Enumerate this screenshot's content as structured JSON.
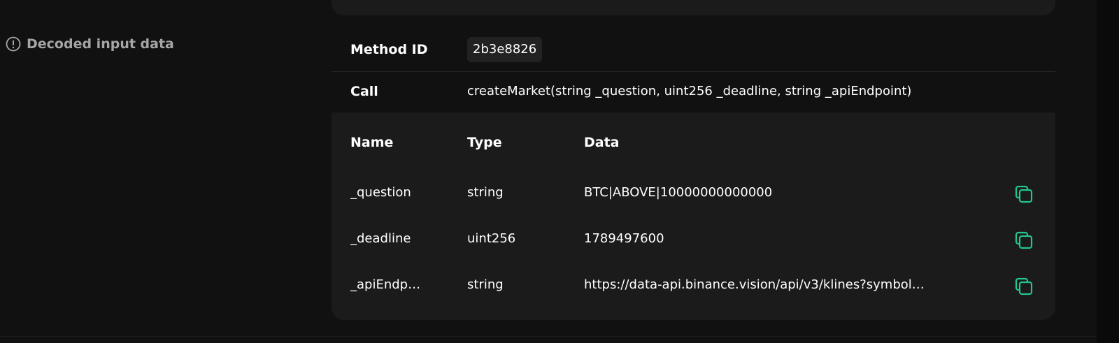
{
  "section": {
    "label": "Decoded input data",
    "icon": "info-circle-icon"
  },
  "method": {
    "label": "Method ID",
    "value": "2b3e8826"
  },
  "call": {
    "label": "Call",
    "value": "createMarket(string _question, uint256 _deadline, string _apiEndpoint)"
  },
  "params": {
    "headers": {
      "name": "Name",
      "type": "Type",
      "data": "Data"
    },
    "rows": [
      {
        "name": "_question",
        "type": "string",
        "data": "BTC|ABOVE|10000000000000",
        "copy_icon": "copy-icon"
      },
      {
        "name": "_deadline",
        "type": "uint256",
        "data": "1789497600",
        "copy_icon": "copy-icon"
      },
      {
        "name": "_apiEndp…",
        "type": "string",
        "data": "https://data-api.binance.vision/api/v3/klines?symbol…",
        "copy_icon": "copy-icon"
      }
    ]
  },
  "colors": {
    "background": "#111111",
    "card": "#1b1b1b",
    "accent_copy": "#22c58a",
    "muted_text": "#a6a6a6"
  }
}
